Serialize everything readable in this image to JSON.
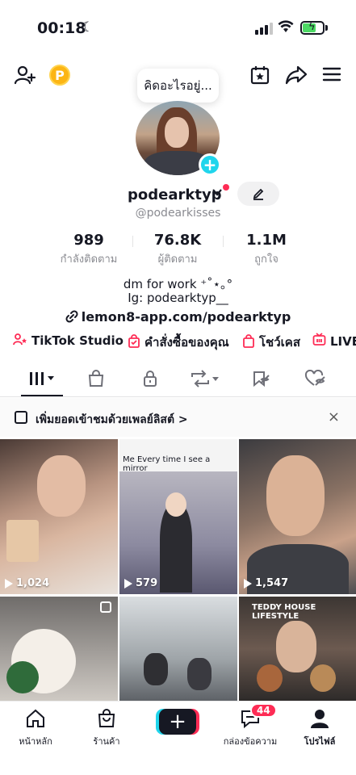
{
  "status_bar": {
    "time": "00:18",
    "moon_icon": "☾"
  },
  "header": {
    "points_label": "P",
    "note_text": "คิดอะไรอยู่..."
  },
  "profile": {
    "username": "podearktyp",
    "handle": "@podearkisses",
    "stats": [
      {
        "value": "989",
        "label": "กำลังติดตาม"
      },
      {
        "value": "76.8K",
        "label": "ผู้ติดตาม"
      },
      {
        "value": "1.1M",
        "label": "ถูกใจ"
      }
    ],
    "bio_line1": "dm for work ⁺˚⋆｡°",
    "bio_line2": "Ig: podearktyp__",
    "link": "lemon8-app.com/podearktyp"
  },
  "shortcuts": [
    {
      "label": "TikTok Studio",
      "icon": "tiktok-studio-icon"
    },
    {
      "label": "คำสั่งซื้อของคุณ",
      "icon": "order-bag-icon"
    },
    {
      "label": "โชว์เคส",
      "icon": "showcase-bag-icon"
    },
    {
      "label": "LIVE",
      "icon": "live-tv-icon"
    }
  ],
  "tabs": [
    "videos-grid-icon",
    "shop-bag-icon",
    "lock-icon",
    "repost-icon",
    "favorites-hidden-icon",
    "liked-hidden-icon"
  ],
  "banner": {
    "text": "เพิ่มยอดเข้าชมด้วยเพลย์ลิสต์ >",
    "close": "×"
  },
  "videos": [
    {
      "views": "1,024"
    },
    {
      "views": "579",
      "caption": "Me Every time I see a mirror"
    },
    {
      "views": "1,547"
    },
    {
      "views": "",
      "caption": ""
    },
    {
      "views": ""
    },
    {
      "views": "",
      "caption": "TEDDY HOUSE LIFESTYLE"
    }
  ],
  "bottom_nav": {
    "home": "หน้าหลัก",
    "shop": "ร้านค้า",
    "create": "+",
    "inbox": "กล่องข้อความ",
    "inbox_badge": "44",
    "profile": "โปรไฟล์"
  },
  "colors": {
    "accent": "#fe2c55",
    "teal": "#20d5ec",
    "text": "#161823",
    "muted": "#8a8b91"
  }
}
